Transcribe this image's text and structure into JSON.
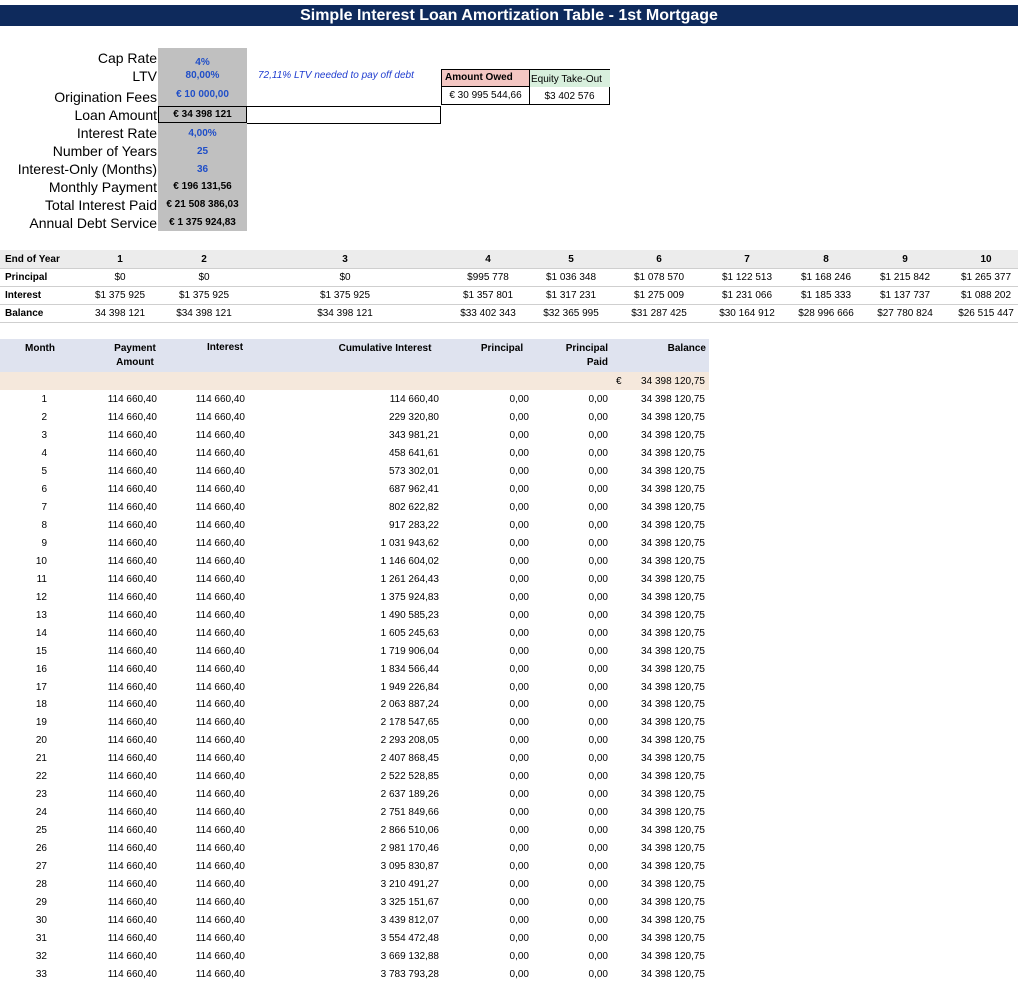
{
  "title": "Simple Interest Loan Amortization Table - 1st Mortgage",
  "params": [
    {
      "label": "Cap Rate",
      "value": "4%",
      "style": "blue"
    },
    {
      "label": "LTV",
      "value": "80,00%",
      "style": "blue"
    },
    {
      "label": "Origination Fees",
      "value": "€ 10 000,00",
      "style": "blue"
    },
    {
      "label": "Loan Amount",
      "value": "€ 34 398 121",
      "style": "black"
    },
    {
      "label": "Interest Rate",
      "value": "4,00%",
      "style": "blue"
    },
    {
      "label": "Number of Years",
      "value": "25",
      "style": "blue"
    },
    {
      "label": "Interest-Only (Months)",
      "value": "36",
      "style": "blue"
    },
    {
      "label": "Monthly Payment",
      "value": "€ 196 131,56",
      "style": "black"
    },
    {
      "label": "Total Interest Paid",
      "value": "€ 21 508 386,03",
      "style": "black"
    },
    {
      "label": "Annual Debt Service",
      "value": "€ 1 375 924,83",
      "style": "black"
    }
  ],
  "ltv_note": "72,11% LTV needed to pay off debt",
  "debt_box": {
    "amount_owed_label": "Amount Owed",
    "equity_label": "Equity Take-Out",
    "amount_owed_value": "€ 30 995 544,66",
    "equity_value": "$3 402 576"
  },
  "yearly": {
    "header_label": "End of Year",
    "years": [
      "1",
      "2",
      "3",
      "4",
      "5",
      "6",
      "7",
      "8",
      "9",
      "10"
    ],
    "rows": [
      {
        "label": "Principal",
        "values": [
          "$0",
          "$0",
          "$0",
          "$995 778",
          "$1 036 348",
          "$1 078 570",
          "$1 122 513",
          "$1 168 246",
          "$1 215 842",
          "$1 265 377"
        ]
      },
      {
        "label": "Interest",
        "values": [
          "$1 375 925",
          "$1 375 925",
          "$1 375 925",
          "$1 357 801",
          "$1 317 231",
          "$1 275 009",
          "$1 231 066",
          "$1 185 333",
          "$1 137 737",
          "$1 088 202"
        ]
      },
      {
        "label": "Balance",
        "values": [
          "34 398 121",
          "$34 398 121",
          "$34 398 121",
          "$33 402 343",
          "$32 365 995",
          "$31 287 425",
          "$30 164 912",
          "$28 996 666",
          "$27 780 824",
          "$26 515 447"
        ]
      }
    ]
  },
  "monthly": {
    "headers": {
      "month": "Month",
      "payment": "Payment Amount",
      "interest": "Interest",
      "cumulative": "Cumulative Interest",
      "principal": "Principal",
      "principal_paid": "Principal Paid",
      "balance": "Balance"
    },
    "opening_currency": "€",
    "opening_balance": "34 398 120,75",
    "rows": [
      [
        "1",
        "114 660,40",
        "114 660,40",
        "114 660,40",
        "0,00",
        "0,00",
        "34 398 120,75"
      ],
      [
        "2",
        "114 660,40",
        "114 660,40",
        "229 320,80",
        "0,00",
        "0,00",
        "34 398 120,75"
      ],
      [
        "3",
        "114 660,40",
        "114 660,40",
        "343 981,21",
        "0,00",
        "0,00",
        "34 398 120,75"
      ],
      [
        "4",
        "114 660,40",
        "114 660,40",
        "458 641,61",
        "0,00",
        "0,00",
        "34 398 120,75"
      ],
      [
        "5",
        "114 660,40",
        "114 660,40",
        "573 302,01",
        "0,00",
        "0,00",
        "34 398 120,75"
      ],
      [
        "6",
        "114 660,40",
        "114 660,40",
        "687 962,41",
        "0,00",
        "0,00",
        "34 398 120,75"
      ],
      [
        "7",
        "114 660,40",
        "114 660,40",
        "802 622,82",
        "0,00",
        "0,00",
        "34 398 120,75"
      ],
      [
        "8",
        "114 660,40",
        "114 660,40",
        "917 283,22",
        "0,00",
        "0,00",
        "34 398 120,75"
      ],
      [
        "9",
        "114 660,40",
        "114 660,40",
        "1 031 943,62",
        "0,00",
        "0,00",
        "34 398 120,75"
      ],
      [
        "10",
        "114 660,40",
        "114 660,40",
        "1 146 604,02",
        "0,00",
        "0,00",
        "34 398 120,75"
      ],
      [
        "11",
        "114 660,40",
        "114 660,40",
        "1 261 264,43",
        "0,00",
        "0,00",
        "34 398 120,75"
      ],
      [
        "12",
        "114 660,40",
        "114 660,40",
        "1 375 924,83",
        "0,00",
        "0,00",
        "34 398 120,75"
      ],
      [
        "13",
        "114 660,40",
        "114 660,40",
        "1 490 585,23",
        "0,00",
        "0,00",
        "34 398 120,75"
      ],
      [
        "14",
        "114 660,40",
        "114 660,40",
        "1 605 245,63",
        "0,00",
        "0,00",
        "34 398 120,75"
      ],
      [
        "15",
        "114 660,40",
        "114 660,40",
        "1 719 906,04",
        "0,00",
        "0,00",
        "34 398 120,75"
      ],
      [
        "16",
        "114 660,40",
        "114 660,40",
        "1 834 566,44",
        "0,00",
        "0,00",
        "34 398 120,75"
      ],
      [
        "17",
        "114 660,40",
        "114 660,40",
        "1 949 226,84",
        "0,00",
        "0,00",
        "34 398 120,75"
      ],
      [
        "18",
        "114 660,40",
        "114 660,40",
        "2 063 887,24",
        "0,00",
        "0,00",
        "34 398 120,75"
      ],
      [
        "19",
        "114 660,40",
        "114 660,40",
        "2 178 547,65",
        "0,00",
        "0,00",
        "34 398 120,75"
      ],
      [
        "20",
        "114 660,40",
        "114 660,40",
        "2 293 208,05",
        "0,00",
        "0,00",
        "34 398 120,75"
      ],
      [
        "21",
        "114 660,40",
        "114 660,40",
        "2 407 868,45",
        "0,00",
        "0,00",
        "34 398 120,75"
      ],
      [
        "22",
        "114 660,40",
        "114 660,40",
        "2 522 528,85",
        "0,00",
        "0,00",
        "34 398 120,75"
      ],
      [
        "23",
        "114 660,40",
        "114 660,40",
        "2 637 189,26",
        "0,00",
        "0,00",
        "34 398 120,75"
      ],
      [
        "24",
        "114 660,40",
        "114 660,40",
        "2 751 849,66",
        "0,00",
        "0,00",
        "34 398 120,75"
      ],
      [
        "25",
        "114 660,40",
        "114 660,40",
        "2 866 510,06",
        "0,00",
        "0,00",
        "34 398 120,75"
      ],
      [
        "26",
        "114 660,40",
        "114 660,40",
        "2 981 170,46",
        "0,00",
        "0,00",
        "34 398 120,75"
      ],
      [
        "27",
        "114 660,40",
        "114 660,40",
        "3 095 830,87",
        "0,00",
        "0,00",
        "34 398 120,75"
      ],
      [
        "28",
        "114 660,40",
        "114 660,40",
        "3 210 491,27",
        "0,00",
        "0,00",
        "34 398 120,75"
      ],
      [
        "29",
        "114 660,40",
        "114 660,40",
        "3 325 151,67",
        "0,00",
        "0,00",
        "34 398 120,75"
      ],
      [
        "30",
        "114 660,40",
        "114 660,40",
        "3 439 812,07",
        "0,00",
        "0,00",
        "34 398 120,75"
      ],
      [
        "31",
        "114 660,40",
        "114 660,40",
        "3 554 472,48",
        "0,00",
        "0,00",
        "34 398 120,75"
      ],
      [
        "32",
        "114 660,40",
        "114 660,40",
        "3 669 132,88",
        "0,00",
        "0,00",
        "34 398 120,75"
      ],
      [
        "33",
        "114 660,40",
        "114 660,40",
        "3 783 793,28",
        "0,00",
        "0,00",
        "34 398 120,75"
      ]
    ]
  }
}
